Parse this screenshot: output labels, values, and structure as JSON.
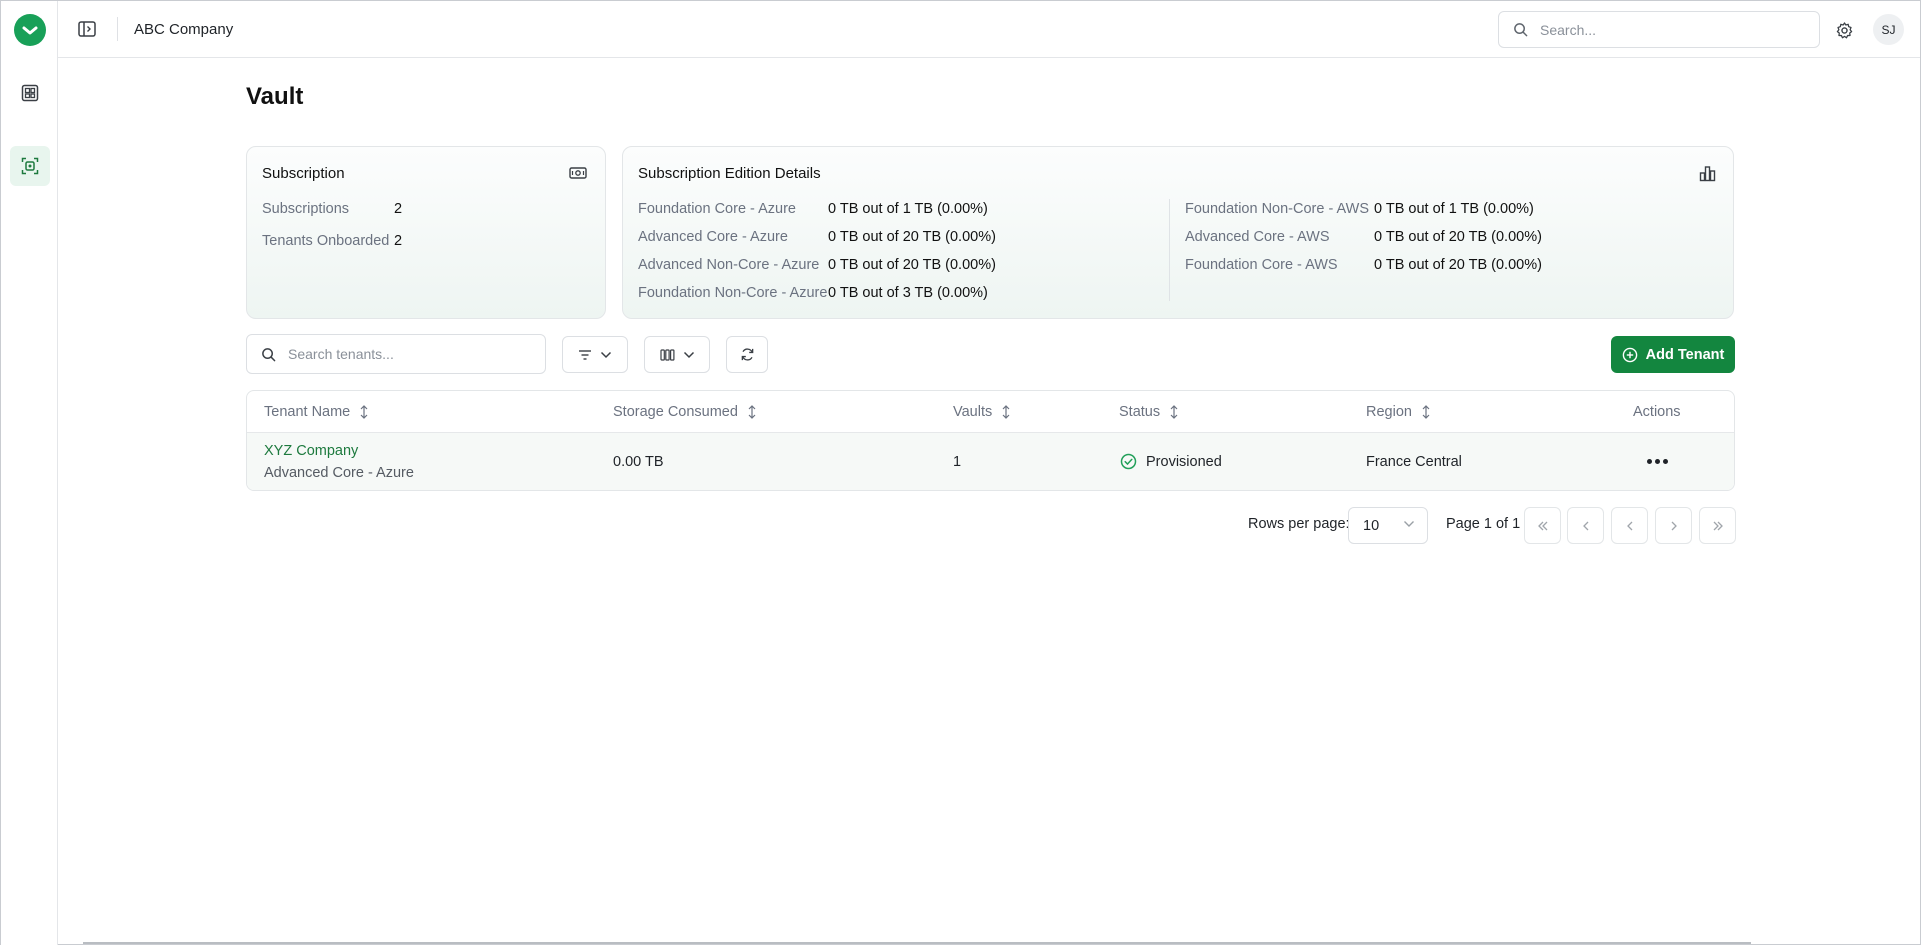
{
  "header": {
    "company": "ABC Company",
    "search_placeholder": "Search...",
    "user_initials": "SJ"
  },
  "sidebar": {
    "items": [
      {
        "name": "dashboard-icon"
      },
      {
        "name": "vault-icon",
        "active": true
      }
    ]
  },
  "page": {
    "title": "Vault"
  },
  "subscription_card": {
    "title": "Subscription",
    "rows": [
      {
        "label": "Subscriptions",
        "value": "2"
      },
      {
        "label": "Tenants Onboarded",
        "value": "2"
      }
    ]
  },
  "edition_card": {
    "title": "Subscription Edition Details",
    "left": [
      {
        "label": "Foundation Core - Azure",
        "value": "0 TB out of 1 TB (0.00%)"
      },
      {
        "label": "Advanced Core - Azure",
        "value": "0 TB out of 20 TB (0.00%)"
      },
      {
        "label": "Advanced Non-Core - Azure",
        "value": "0 TB out of 20 TB (0.00%)"
      },
      {
        "label": "Foundation Non-Core - Azure",
        "value": "0 TB out of 3 TB (0.00%)"
      }
    ],
    "right": [
      {
        "label": "Foundation Non-Core - AWS",
        "value": "0 TB out of 1 TB (0.00%)"
      },
      {
        "label": "Advanced Core - AWS",
        "value": "0 TB out of 20 TB (0.00%)"
      },
      {
        "label": "Foundation Core - AWS",
        "value": "0 TB out of 20 TB (0.00%)"
      }
    ]
  },
  "toolbar": {
    "search_placeholder": "Search tenants...",
    "add_label": "Add Tenant"
  },
  "table": {
    "columns": [
      "Tenant Name",
      "Storage Consumed",
      "Vaults",
      "Status",
      "Region",
      "Actions"
    ],
    "rows": [
      {
        "tenant": "XYZ Company",
        "edition": "Advanced Core - Azure",
        "storage": "0.00 TB",
        "vaults": "1",
        "status": "Provisioned",
        "region": "France Central"
      }
    ]
  },
  "pagination": {
    "rows_per_page_label": "Rows per page:",
    "rows_per_page": "10",
    "page_info": "Page 1 of 1"
  },
  "colors": {
    "brand": "#18a058",
    "primary_button": "#13863f",
    "link": "#1d7a3e",
    "active_nav_bg": "#e8f5ee"
  }
}
